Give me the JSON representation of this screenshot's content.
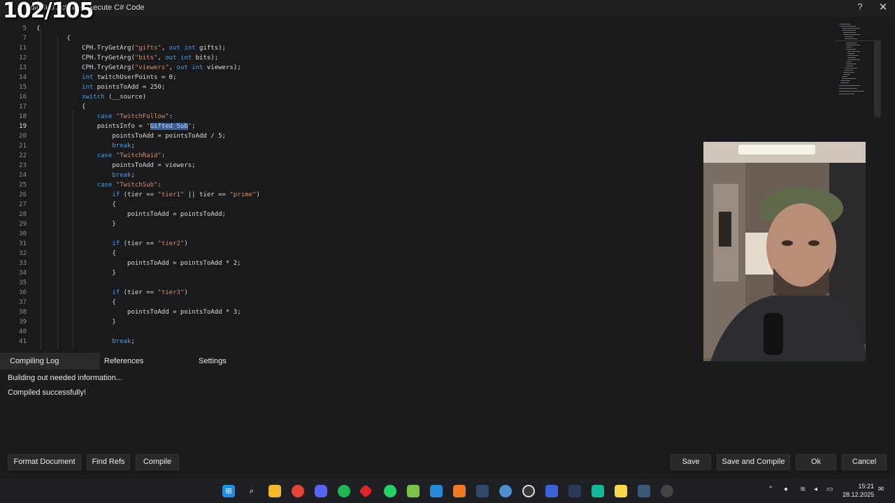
{
  "counter": "102/105",
  "window": {
    "title": "Edit Sub Action - Execute C# Code",
    "help_label": "?",
    "close_label": "✕"
  },
  "editor": {
    "active_line": "19",
    "lines": [
      {
        "no": "5",
        "text": "{"
      },
      {
        "no": "7",
        "text": "        {"
      },
      {
        "no": "11",
        "text": "            CPH.TryGetArg(\"gifts\", out int gifts);"
      },
      {
        "no": "12",
        "text": "            CPH.TryGetArg(\"bits\", out int bits);"
      },
      {
        "no": "13",
        "text": "            CPH.TryGetArg(\"viewers\", out int viewers);"
      },
      {
        "no": "14",
        "text": "            int twitchUserPoints = 0;"
      },
      {
        "no": "15",
        "text": "            int pointsToAdd = 250;"
      },
      {
        "no": "16",
        "text": "            switch (__source)"
      },
      {
        "no": "17",
        "text": "            {"
      },
      {
        "no": "18",
        "text": "                case \"TwitchFollow\":"
      },
      {
        "no": "19",
        "text": "                pointsInfo = \"Gifted Sub\";"
      },
      {
        "no": "20",
        "text": "                    pointsToAdd = pointsToAdd / 5;"
      },
      {
        "no": "21",
        "text": "                    break;"
      },
      {
        "no": "22",
        "text": "                case \"TwitchRaid\":"
      },
      {
        "no": "23",
        "text": "                    pointsToAdd = viewers;"
      },
      {
        "no": "24",
        "text": "                    break;"
      },
      {
        "no": "25",
        "text": "                case \"TwitchSub\":"
      },
      {
        "no": "26",
        "text": "                    if (tier == \"tier1\" || tier == \"prime\")"
      },
      {
        "no": "27",
        "text": "                    {"
      },
      {
        "no": "28",
        "text": "                        pointsToAdd = pointsToAdd;"
      },
      {
        "no": "29",
        "text": "                    }"
      },
      {
        "no": "30",
        "text": ""
      },
      {
        "no": "31",
        "text": "                    if (tier == \"tier2\")"
      },
      {
        "no": "32",
        "text": "                    {"
      },
      {
        "no": "33",
        "text": "                        pointsToAdd = pointsToAdd * 2;"
      },
      {
        "no": "34",
        "text": "                    }"
      },
      {
        "no": "35",
        "text": ""
      },
      {
        "no": "36",
        "text": "                    if (tier == \"tier3\")"
      },
      {
        "no": "37",
        "text": "                    {"
      },
      {
        "no": "38",
        "text": "                        pointsToAdd = pointsToAdd * 3;"
      },
      {
        "no": "39",
        "text": "                    }"
      },
      {
        "no": "40",
        "text": ""
      },
      {
        "no": "41",
        "text": "                    break;"
      }
    ]
  },
  "panel": {
    "tabs": [
      "Compiling Log",
      "References",
      "Settings"
    ],
    "log": [
      "Building out needed information...",
      "Compiled successfully!"
    ]
  },
  "buttons": {
    "format_document": "Format Document",
    "find_refs": "Find Refs",
    "compile": "Compile",
    "save": "Save",
    "save_and_compile": "Save and Compile",
    "ok": "Ok",
    "cancel": "Cancel"
  },
  "taskbar": {
    "apps": [
      "windows-start",
      "search",
      "file-explorer",
      "chrome",
      "discord",
      "spotify",
      "app-red",
      "whatsapp",
      "notepad-green",
      "vscode",
      "app-orange",
      "steam",
      "app-blue",
      "obs",
      "streamerbot",
      "audio-app",
      "app-teal",
      "sticky-notes",
      "davinci",
      "chatgpt"
    ],
    "time": "15:21",
    "date": "28.12.2025"
  },
  "colors": {
    "keyword": "#569cd6",
    "string": "#ce9178",
    "selection": "#3b5f9a",
    "background": "#1a1a1c"
  }
}
